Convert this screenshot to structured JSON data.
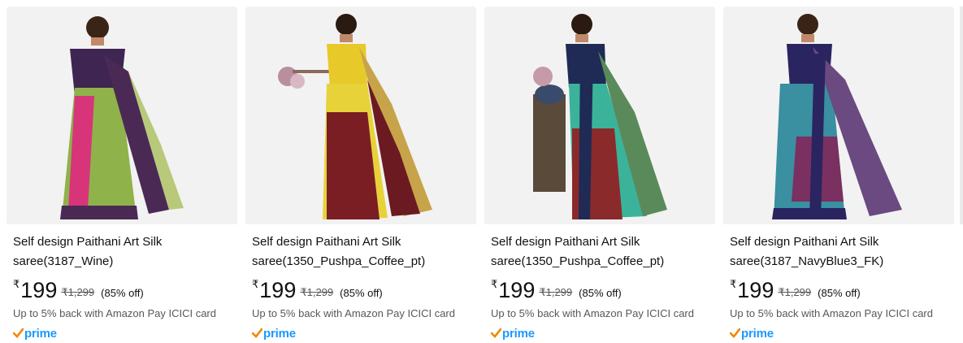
{
  "products": [
    {
      "title": "Self design Paithani Art Silk saree(3187_Wine)",
      "currency": "₹",
      "price": "199",
      "mrp": "₹1,299",
      "discount": "(85% off)",
      "offer": "Up to 5% back with Amazon Pay ICICI card",
      "badge": "prime",
      "colors": {
        "blouse": "#3f2552",
        "body": "#8fb24a",
        "accent": "#d8347a",
        "border": "#4a2a55",
        "pallu": "#b8c97a"
      }
    },
    {
      "title": "Self design Paithani Art Silk saree(1350_Pushpa_Coffee_pt)",
      "currency": "₹",
      "price": "199",
      "mrp": "₹1,299",
      "discount": "(85% off)",
      "offer": "Up to 5% back with Amazon Pay ICICI card",
      "badge": "prime",
      "colors": {
        "blouse": "#e8c92a",
        "body": "#e8d23a",
        "accent": "#7a1e24",
        "border": "#6b1a22",
        "pallu": "#c7a44a"
      }
    },
    {
      "title": "Self design Paithani Art Silk saree(1350_Pushpa_Coffee_pt)",
      "currency": "₹",
      "price": "199",
      "mrp": "₹1,299",
      "discount": "(85% off)",
      "offer": "Up to 5% back with Amazon Pay ICICI card",
      "badge": "prime",
      "colors": {
        "blouse": "#1f2a55",
        "body": "#3bb39a",
        "accent": "#8a2a2a",
        "border": "#1f2a55",
        "pallu": "#5a8a5a"
      }
    },
    {
      "title": "Self design Paithani Art Silk saree(3187_NavyBlue3_FK)",
      "currency": "₹",
      "price": "199",
      "mrp": "₹1,299",
      "discount": "(85% off)",
      "offer": "Up to 5% back with Amazon Pay ICICI card",
      "badge": "prime",
      "colors": {
        "blouse": "#2a2460",
        "body": "#3a8fa0",
        "accent": "#7a3060",
        "border": "#2a2460",
        "pallu": "#6a4a80"
      }
    }
  ]
}
